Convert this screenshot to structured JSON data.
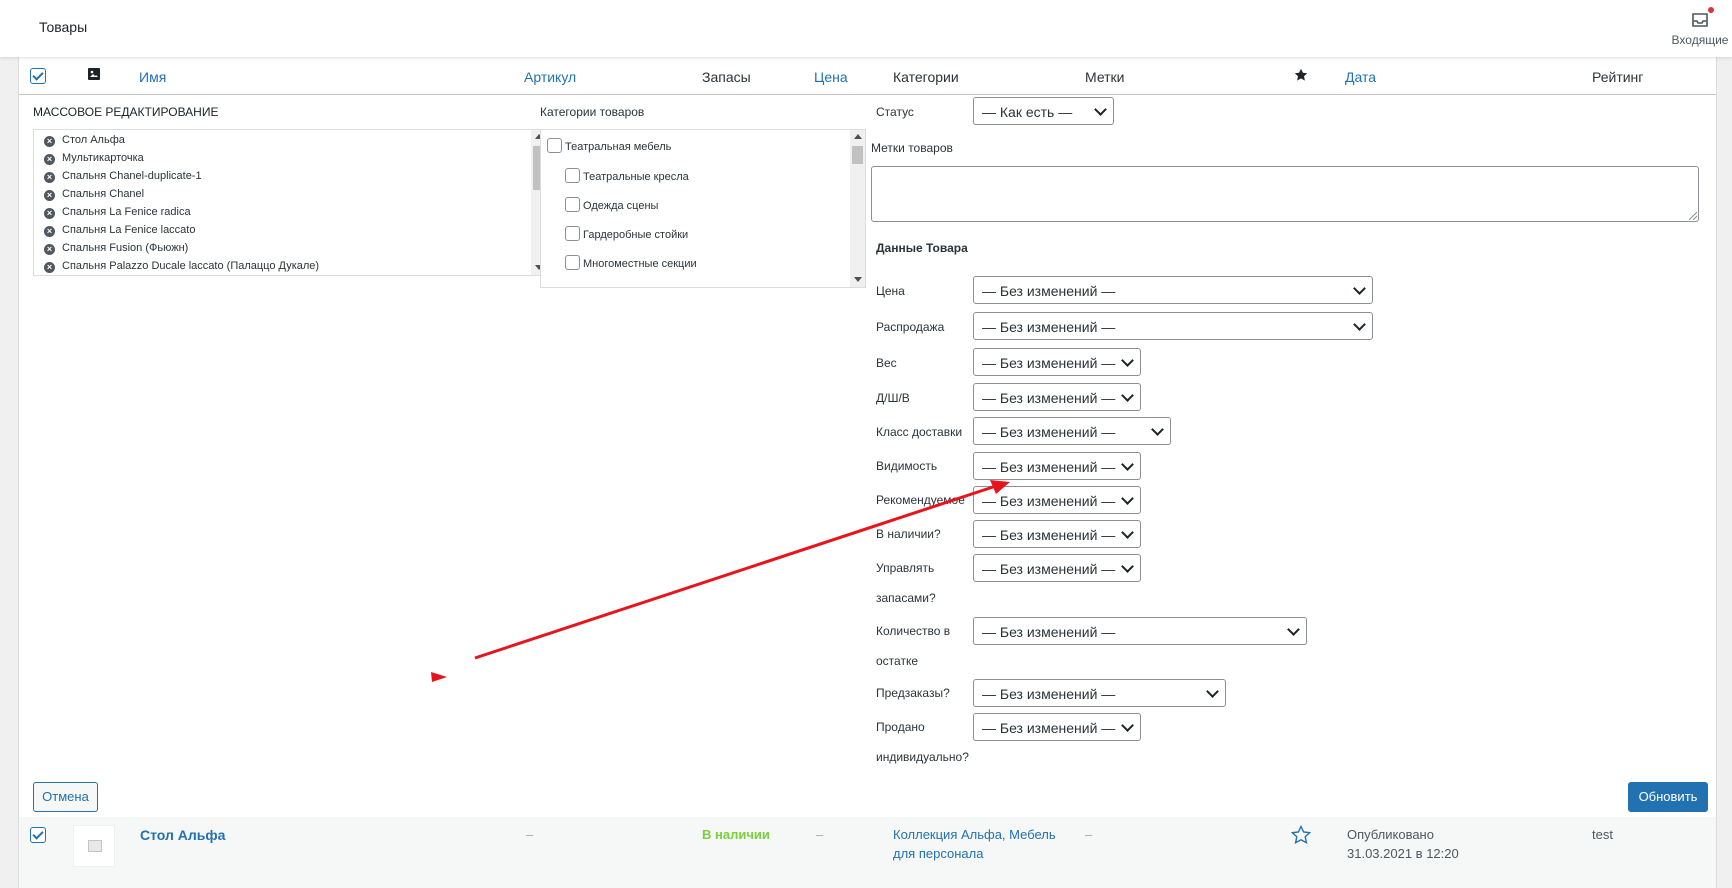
{
  "page": {
    "title": "Товары",
    "inbox_label": "Входящие"
  },
  "table_header": {
    "name": "Имя",
    "sku": "Артикул",
    "stock": "Запасы",
    "price": "Цена",
    "categories": "Категории",
    "tags": "Метки",
    "featured_icon": "star-icon",
    "date": "Дата",
    "rating": "Рейтинг"
  },
  "bulk_edit": {
    "title": "МАССОВОЕ РЕДАКТИРОВАНИЕ",
    "selected_items": [
      "Стол Альфа",
      "Мультикарточка",
      "Спальня Chanel-duplicate-1",
      "Спальня Chanel",
      "Спальня La Fenice radica",
      "Спальня La Fenice laccato",
      "Спальня Fusion (Фьюжн)",
      "Спальня Palazzo Ducale laccato (Палаццо Дукале)"
    ],
    "categories_title": "Категории товаров",
    "categories": [
      {
        "label": "Театральная мебель",
        "level": 0
      },
      {
        "label": "Театральные кресла",
        "level": 1
      },
      {
        "label": "Одежда сцены",
        "level": 1
      },
      {
        "label": "Гардеробные стойки",
        "level": 1
      },
      {
        "label": "Многоместные секции",
        "level": 1
      }
    ],
    "status_label": "Статус",
    "status_value": "— Как есть —",
    "tags_label": "Метки товаров",
    "tags_value": "",
    "product_data_title": "Данные Товара",
    "fields": [
      {
        "label": "Цена",
        "value": "— Без изменений —"
      },
      {
        "label": "Распродажа",
        "value": "— Без изменений —"
      },
      {
        "label": "Вес",
        "value": "— Без изменений —"
      },
      {
        "label": "Д/Ш/В",
        "value": "— Без изменений —"
      },
      {
        "label": "Класс доставки",
        "value": "— Без изменений —"
      },
      {
        "label": "Видимость",
        "value": "— Без изменений —"
      },
      {
        "label": "Рекомендуемое",
        "value": "— Без изменений —"
      },
      {
        "label": "В наличии?",
        "value": "— Без изменений —"
      },
      {
        "label": "Управлять",
        "label2": "запасами?",
        "value": "— Без изменений —"
      },
      {
        "label": "Количество в",
        "label2": "остатке",
        "value": "— Без изменений —"
      },
      {
        "label": "Предзаказы?",
        "value": "— Без изменений —"
      },
      {
        "label": "Продано",
        "label2": "индивидуально?",
        "value": "— Без изменений —"
      }
    ],
    "cancel_label": "Отмена",
    "update_label": "Обновить"
  },
  "product_row": {
    "name": "Стол Альфа",
    "sku": "–",
    "stock": "В наличии",
    "price": "–",
    "categories_line1": "Коллекция Альфа, Мебель",
    "categories_line2": "для персонала",
    "tags": "–",
    "date_status": "Опубликовано",
    "date_value": "31.03.2021 в 12:20",
    "rating": "test"
  },
  "colors": {
    "accent": "#2271b1",
    "in_stock": "#7ad03a",
    "annotation": "#e8141c"
  }
}
